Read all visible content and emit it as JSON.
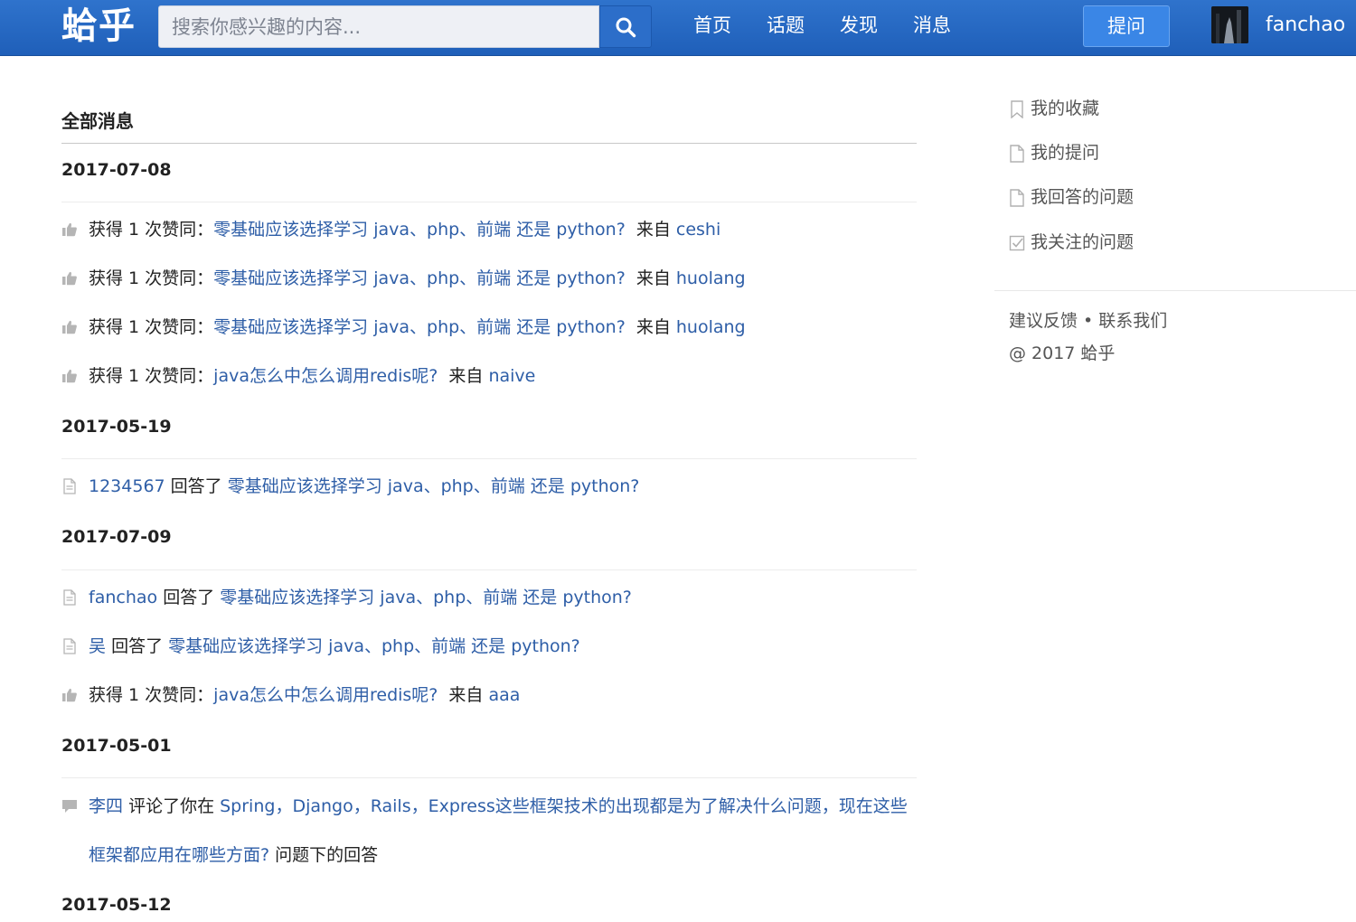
{
  "header": {
    "logo": "蛤乎",
    "search_placeholder": "搜索你感兴趣的内容...",
    "nav": [
      "首页",
      "话题",
      "发现",
      "消息"
    ],
    "ask_label": "提问",
    "username": "fanchao"
  },
  "main": {
    "title": "全部消息",
    "groups": [
      {
        "date": "2017-07-08",
        "items": [
          {
            "type": "like",
            "prefix": "获得 1 次赞同：",
            "question": "零基础应该选择学习 java、php、前端 还是 python?",
            "from_label": "来自",
            "user": "ceshi"
          },
          {
            "type": "like",
            "prefix": "获得 1 次赞同：",
            "question": "零基础应该选择学习 java、php、前端 还是 python?",
            "from_label": "来自",
            "user": "huolang"
          },
          {
            "type": "like",
            "prefix": "获得 1 次赞同：",
            "question": "零基础应该选择学习 java、php、前端 还是 python?",
            "from_label": "来自",
            "user": "huolang"
          },
          {
            "type": "like",
            "prefix": "获得 1 次赞同：",
            "question": "java怎么中怎么调用redis呢?",
            "from_label": "来自",
            "user": "naive"
          }
        ]
      },
      {
        "date": "2017-05-19",
        "items": [
          {
            "type": "answer",
            "user": "1234567",
            "verb": "回答了",
            "question": "零基础应该选择学习 java、php、前端 还是 python?"
          }
        ]
      },
      {
        "date": "2017-07-09",
        "items": [
          {
            "type": "answer",
            "user": "fanchao",
            "verb": "回答了",
            "question": "零基础应该选择学习 java、php、前端 还是 python?"
          },
          {
            "type": "answer",
            "user": "吴",
            "verb": "回答了",
            "question": "零基础应该选择学习 java、php、前端 还是 python?"
          },
          {
            "type": "like",
            "prefix": "获得 1 次赞同：",
            "question": "java怎么中怎么调用redis呢?",
            "from_label": "来自",
            "user": "aaa"
          }
        ]
      },
      {
        "date": "2017-05-01",
        "items": [
          {
            "type": "comment",
            "user": "李四",
            "verb": "评论了你在",
            "question": "Spring，Django，Rails，Express这些框架技术的出现都是为了解决什么问题，现在这些框架都应用在哪些方面?",
            "suffix": "问题下的回答"
          }
        ]
      },
      {
        "date": "2017-05-12",
        "items": []
      }
    ]
  },
  "sidebar": {
    "items": [
      "我的收藏",
      "我的提问",
      "我回答的问题",
      "我关注的问题"
    ],
    "footer_links": "建议反馈 • 联系我们",
    "copyright": "@ 2017 蛤乎"
  },
  "colors": {
    "header_bg": "#2567c4",
    "link": "#2e5ea7",
    "ask_button": "#3a86e6"
  },
  "icons": {
    "search": "search-icon",
    "like": "thumbs-up-icon",
    "answer": "document-icon",
    "comment": "comment-icon",
    "favorites": "bookmark-icon",
    "questions": "file-icon",
    "answered": "file-icon",
    "following": "checkbox-icon"
  }
}
